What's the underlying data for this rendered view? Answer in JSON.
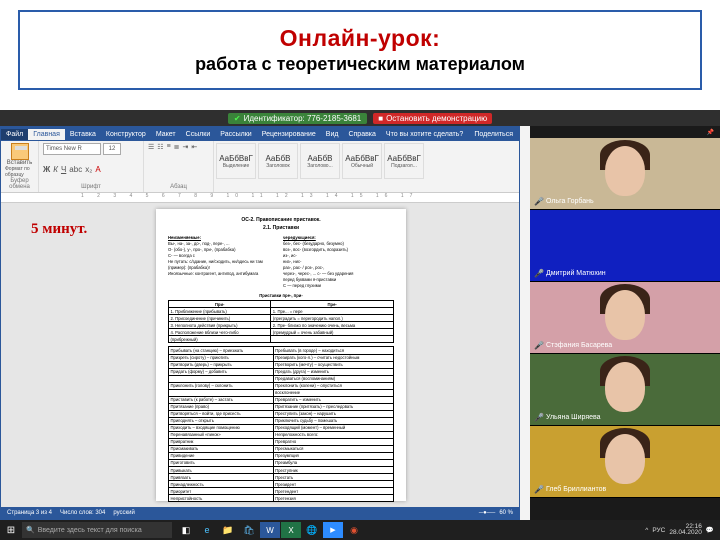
{
  "slide": {
    "title": "Онлайн-урок:",
    "subtitle": "работа с теоретическим материалом"
  },
  "zoom_bar": {
    "id_label": "Идентификатор: 776-2185-3681",
    "stop_label": "Остановить демонстрацию"
  },
  "word": {
    "tabs": [
      "Файл",
      "Главная",
      "Вставка",
      "Конструктор",
      "Макет",
      "Ссылки",
      "Рассылки",
      "Рецензирование",
      "Вид",
      "Справка",
      "Что вы хотите сделать?"
    ],
    "active_tab": "Главная",
    "share": "Поделиться",
    "paste_label": "Вставить",
    "format_painter": "Формат по образцу",
    "clipboard_label": "Буфер обмена",
    "font_name": "Times New R",
    "font_size": "12",
    "font_label": "Шрифт",
    "para_label": "Абзац",
    "styles": [
      {
        "prev": "АаБбВвГ",
        "name": "Выделение"
      },
      {
        "prev": "АаБбВ",
        "name": "Заголовок"
      },
      {
        "prev": "АаБбВ",
        "name": "Заголово..."
      },
      {
        "prev": "АаБбВвГ",
        "name": "Обычный"
      },
      {
        "prev": "АаБбВвГ",
        "name": "Подзагол..."
      }
    ],
    "styles_label": "Стили",
    "ruler_marks": "1 2 3 4 5 6 7 8 9 10 11 12 13 14 15 16 17",
    "timer": "5 минут.",
    "status": {
      "page": "Страница 3 из 4",
      "words": "Число слов: 304",
      "lang": "русский",
      "zoom": "60 %"
    }
  },
  "doc": {
    "heading": "ОС-2. Правописание приставок.",
    "sub": "2.1. Приставки",
    "col_left_h": "Неизменяемые:",
    "col_left": [
      "Вы-, на-, за-, до-, под-, пере-, ...",
      "О- (обо-), у-, про-, при-, (прабабка)",
      "С- — всегда с",
      "Не путать: с/здание, ни/сходить, ни/здесь ни там",
      "(пример): (прабабка)!",
      "Иноязычные: контрагент, антипод, антибумага"
    ],
    "col_right_h": "чередующиеся:",
    "col_right": [
      "без-, бес- (безударно, безумно)",
      "воз-, вос- (возгордить, возразить)",
      "из-, ис-",
      "низ-, нис-",
      "раз-, рас- / роз-, рос-,",
      "через-, черес-, ... с- — без ударения",
      "перед буквами я-приставки",
      "С — перед глухими"
    ],
    "sec2": "Приставки пре-, при-",
    "table1": [
      [
        "При-",
        "Пре-"
      ],
      [
        "1. Приближение (прибывать)",
        "1. Пре... = пере"
      ],
      [
        "2. Присоединение (причинить)",
        "(преградить = перегородить напол.)"
      ],
      [
        "3. Неполнота действия (прикрыть)",
        "2. Пре- близко по значению очень, весьма"
      ],
      [
        "4. Расположение вблизи чего-либо",
        "(премудрый = очень забавный)"
      ],
      [
        "(прибрежный)",
        ""
      ]
    ],
    "table2": [
      [
        "Прибывать (на станцию) – приезжать",
        "Пребывать (в городе) – находиться"
      ],
      [
        "Призреть (сироту) – приютить",
        "Презирать (кого-л.) – считать недостойным"
      ],
      [
        "Притворить (дверь) – прикрыть",
        "Претворить (мечту) – осуществить"
      ],
      [
        "Придать (форму) – добавить",
        "Предать (друга) – изменить"
      ],
      [
        "",
        "Предаваться (воспоминаниям)"
      ],
      [
        "Приклонить (голову) – склонить",
        "Преклонить (колени) – опуститься"
      ],
      [
        "",
        "восклонение"
      ],
      [
        "Приставить (к работе) – застать",
        "Превратить – изменить"
      ],
      [
        "Притязание (право)",
        "Притязание (притязать) – преследовать"
      ],
      [
        "Притворяться – войти, где присесть",
        "Преступить (закон) – нарушить"
      ],
      [
        "Приподнять – открыть",
        "Приключить судьбу – помешать"
      ],
      [
        "Приходить – входящие помощению",
        "Преходящий (момент) – временный"
      ],
      [
        "Перенавязанный «пинок»",
        "Непреложность всего:"
      ],
      [
        "Привратник",
        "Превратно"
      ],
      [
        "Присмакивать",
        "Пресмыкаться"
      ],
      [
        "Привидение",
        "Презумпция"
      ],
      [
        "Приготовить",
        "Преамбула"
      ],
      [
        "Привыкать",
        "Преступник"
      ],
      [
        "Привязать",
        "Престать"
      ],
      [
        "Принадлежность",
        "Президент"
      ],
      [
        "Приоритет",
        "Претендент"
      ],
      [
        "Непристойность",
        "Претензия"
      ]
    ]
  },
  "participants": [
    {
      "name": "Ольга Горбань",
      "kind": "face",
      "bg": "p-beige"
    },
    {
      "name": "Дмитрий Матюхин",
      "kind": "blank",
      "bg": "p-blue"
    },
    {
      "name": "Стэфания Басарева",
      "kind": "face",
      "bg": "p-pink"
    },
    {
      "name": "Ульяна Ширяева",
      "kind": "face",
      "bg": "p-green"
    },
    {
      "name": "Глеб Бриллиантов",
      "kind": "face",
      "bg": "p-yellow"
    }
  ],
  "taskbar": {
    "search_placeholder": "Введите здесь текст для поиска",
    "time": "22:16",
    "date": "28.04.2020",
    "lang": "РУС"
  }
}
